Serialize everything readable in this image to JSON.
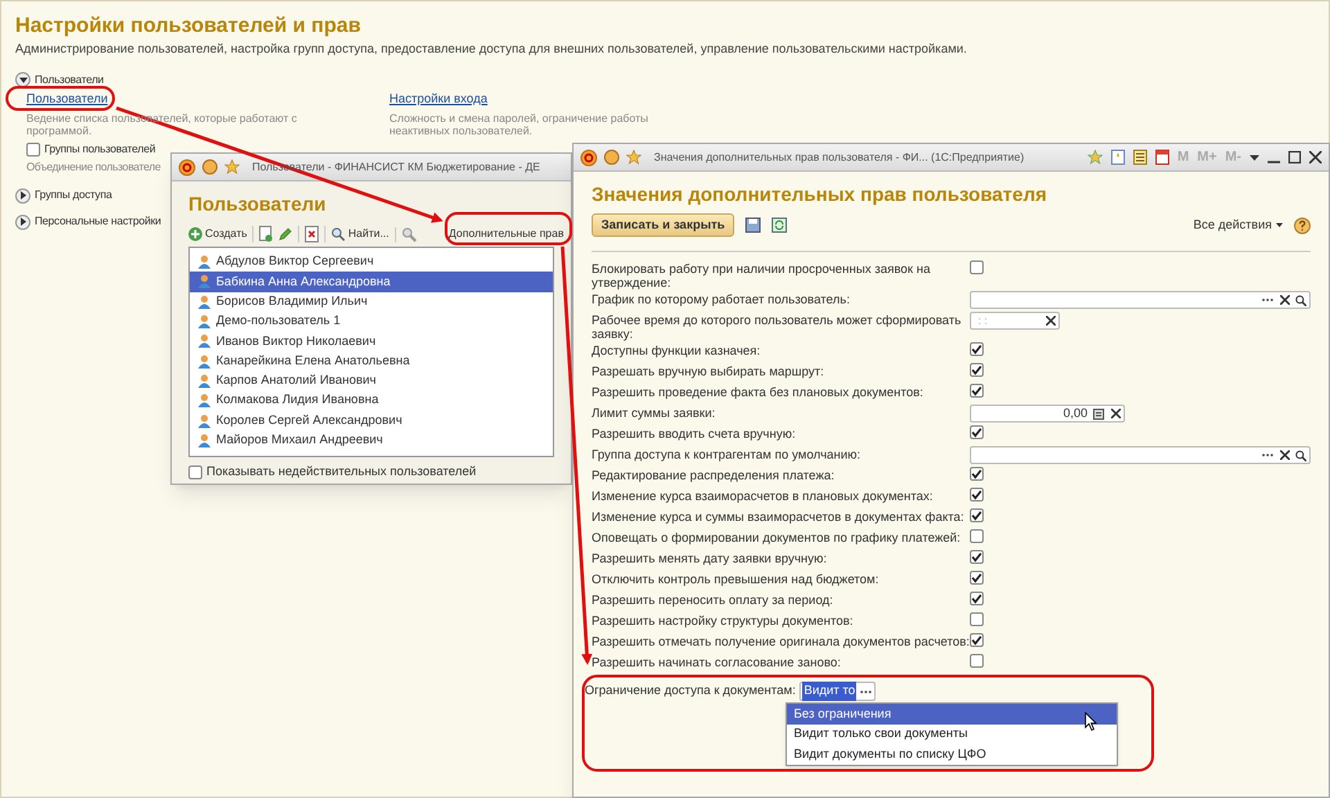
{
  "page": {
    "title": "Настройки пользователей и прав",
    "description": "Администрирование пользователей, настройка групп доступа, предоставление доступа для внешних пользователей, управление пользовательскими настройками.",
    "sections": [
      {
        "label": "Пользователи",
        "expanded": true
      },
      {
        "label": "Группы доступа",
        "expanded": false
      },
      {
        "label": "Персональные настройки",
        "expanded": false
      }
    ],
    "users_link": {
      "label": "Пользователи",
      "description": "Ведение списка пользователей, которые работают с программой."
    },
    "groups_option": {
      "label": "Группы пользователей",
      "checked": false,
      "description": "Объединение пользователе"
    },
    "login_link": {
      "label": "Настройки входа",
      "description": "Сложность и смена паролей, ограничение работы неактивных пользователей."
    }
  },
  "users_window": {
    "title": "Пользователи - ФИНАНСИСТ КМ Бюджетирование - ДЕ",
    "heading": "Пользователи",
    "toolbar": [
      {
        "kind": "create",
        "label": "Создать"
      },
      {
        "kind": "copy"
      },
      {
        "kind": "edit"
      },
      {
        "kind": "delete"
      },
      {
        "kind": "find",
        "label": "Найти..."
      },
      {
        "kind": "tool"
      },
      {
        "kind": "text",
        "label": "Дополнительные прав"
      }
    ],
    "users": [
      {
        "name": "Абдулов Виктор Сергеевич",
        "selected": false
      },
      {
        "name": "Бабкина Анна Александровна",
        "selected": true
      },
      {
        "name": "Борисов Владимир Ильич",
        "selected": false
      },
      {
        "name": "Демо-пользователь 1",
        "selected": false
      },
      {
        "name": "Иванов Виктор Николаевич",
        "selected": false
      },
      {
        "name": "Канарейкина Елена Анатольевна",
        "selected": false
      },
      {
        "name": "Карпов Анатолий Иванович",
        "selected": false
      },
      {
        "name": "Колмакова Лидия Ивановна",
        "selected": false
      },
      {
        "name": "Королев Сергей Александрович",
        "selected": false
      },
      {
        "name": "Майоров Михаил Андреевич",
        "selected": false
      }
    ],
    "show_inactive": {
      "label": "Показывать недействительных пользователей",
      "checked": false
    }
  },
  "rights_window": {
    "title": "Значения дополнительных прав пользователя - ФИ...  (1С:Предприятие)",
    "memory_buttons": [
      "M",
      "M+",
      "M-"
    ],
    "heading": "Значения дополнительных прав пользователя",
    "save_button": "Записать и закрыть",
    "all_actions": "Все действия",
    "rows": [
      {
        "label": "Блокировать работу при наличии просроченных заявок на утверждение:",
        "kind": "checkbox",
        "checked": false
      },
      {
        "label": "График по которому работает пользователь:",
        "kind": "ref"
      },
      {
        "label": "Рабочее время до которого пользователь может сформировать заявку:",
        "kind": "time",
        "placeholder": ": :"
      },
      {
        "label": "Доступны функции казначея:",
        "kind": "checkbox",
        "checked": true
      },
      {
        "label": "Разрешать вручную выбирать маршрут:",
        "kind": "checkbox",
        "checked": true
      },
      {
        "label": "Разрешить проведение факта без плановых документов:",
        "kind": "checkbox",
        "checked": true
      },
      {
        "label": "Лимит суммы заявки:",
        "kind": "number",
        "value": "0,00"
      },
      {
        "label": "Разрешить вводить счета вручную:",
        "kind": "checkbox",
        "checked": true
      },
      {
        "label": "Группа доступа к контрагентам по умолчанию:",
        "kind": "ref"
      },
      {
        "label": "Редактирование распределения платежа:",
        "kind": "checkbox",
        "checked": true
      },
      {
        "label": "Изменение курса взаиморасчетов в плановых документах:",
        "kind": "checkbox",
        "checked": true
      },
      {
        "label": "Изменение курса и суммы взаиморасчетов в документах факта:",
        "kind": "checkbox",
        "checked": true
      },
      {
        "label": "Оповещать о формировании документов по графику платежей:",
        "kind": "checkbox",
        "checked": false
      },
      {
        "label": "Разрешить менять дату заявки вручную:",
        "kind": "checkbox",
        "checked": true
      },
      {
        "label": "Отключить контроль превышения над бюджетом:",
        "kind": "checkbox",
        "checked": true
      },
      {
        "label": "Разрешить переносить оплату за период:",
        "kind": "checkbox",
        "checked": true
      },
      {
        "label": "Разрешить настройку структуры документов:",
        "kind": "checkbox",
        "checked": false
      },
      {
        "label": "Разрешить отмечать получение оригинала документов расчетов:",
        "kind": "checkbox",
        "checked": true
      },
      {
        "label": "Разрешить начинать согласование заново:",
        "kind": "checkbox",
        "checked": false
      }
    ],
    "access": {
      "label": "Ограничение доступа к документам:",
      "value": "Видит то",
      "options": [
        {
          "label": "Без ограничения",
          "selected": true
        },
        {
          "label": "Видит только свои документы",
          "selected": false
        },
        {
          "label": "Видит документы по списку ЦФО",
          "selected": false
        }
      ]
    }
  }
}
